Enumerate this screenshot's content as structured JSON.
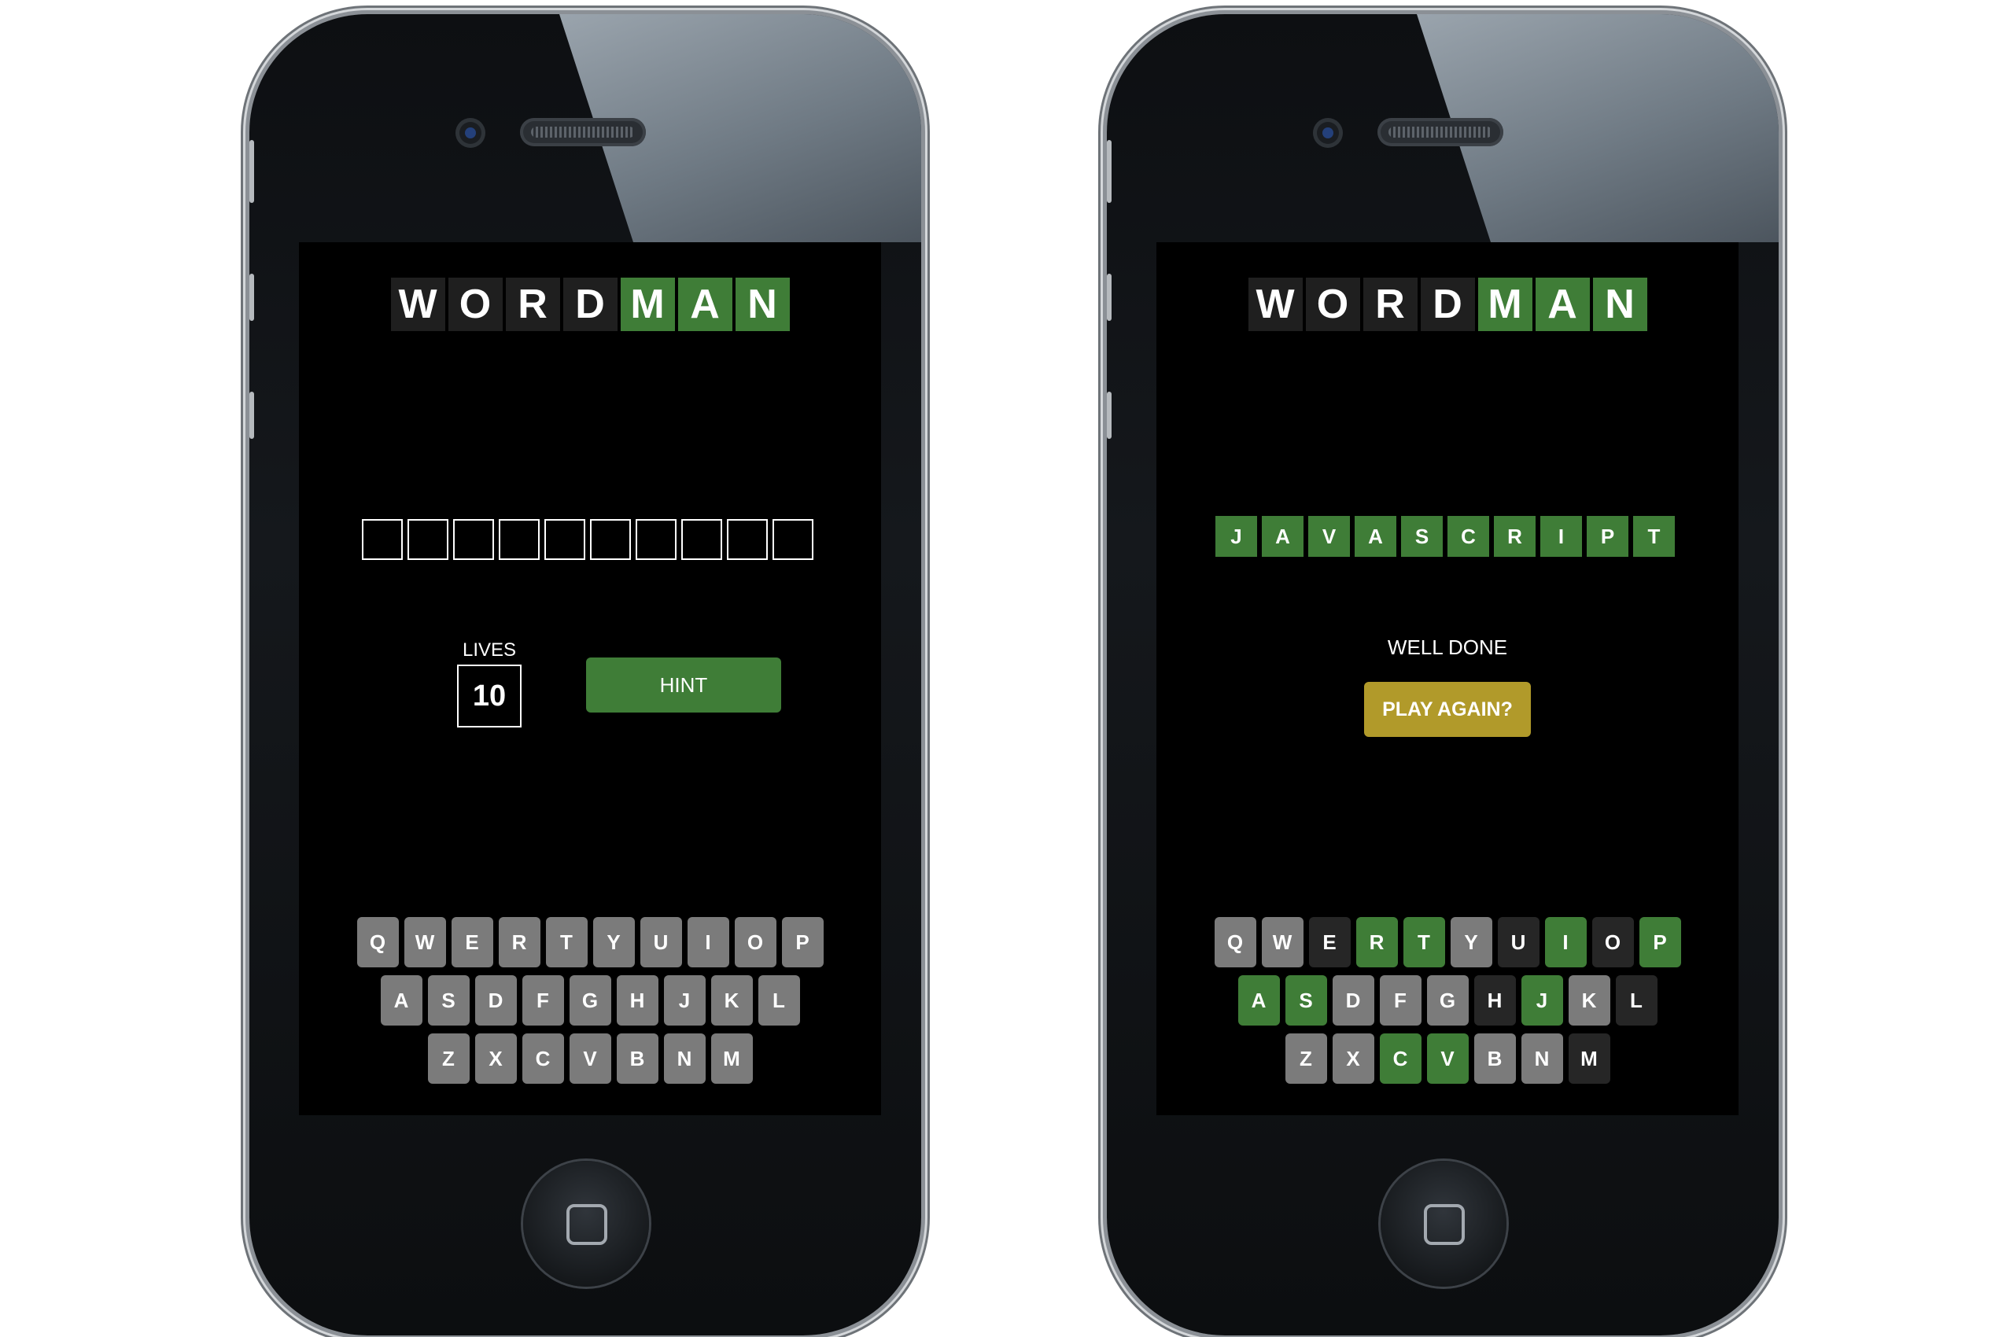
{
  "colors": {
    "correct": "#3f7d37",
    "absent": "#262626",
    "unused": "#7b7b7b",
    "play_again": "#b19a2a"
  },
  "title_letters": [
    "W",
    "O",
    "R",
    "D",
    "M",
    "A",
    "N"
  ],
  "left_screen": {
    "blank_count": 10,
    "lives_label": "LIVES",
    "lives": "10",
    "hint_label": "HINT",
    "keyboard": [
      [
        "Q",
        "W",
        "E",
        "R",
        "T",
        "Y",
        "U",
        "I",
        "O",
        "P"
      ],
      [
        "A",
        "S",
        "D",
        "F",
        "G",
        "H",
        "J",
        "K",
        "L"
      ],
      [
        "Z",
        "X",
        "C",
        "V",
        "B",
        "N",
        "M"
      ]
    ]
  },
  "right_screen": {
    "word": [
      "J",
      "A",
      "V",
      "A",
      "S",
      "C",
      "R",
      "I",
      "P",
      "T"
    ],
    "message": "WELL DONE",
    "play_again_label": "PLAY AGAIN?",
    "keyboard": [
      [
        {
          "key": "Q",
          "state": "unused"
        },
        {
          "key": "W",
          "state": "unused"
        },
        {
          "key": "E",
          "state": "absent"
        },
        {
          "key": "R",
          "state": "correct"
        },
        {
          "key": "T",
          "state": "correct"
        },
        {
          "key": "Y",
          "state": "unused"
        },
        {
          "key": "U",
          "state": "absent"
        },
        {
          "key": "I",
          "state": "correct"
        },
        {
          "key": "O",
          "state": "absent"
        },
        {
          "key": "P",
          "state": "correct"
        }
      ],
      [
        {
          "key": "A",
          "state": "correct"
        },
        {
          "key": "S",
          "state": "correct"
        },
        {
          "key": "D",
          "state": "unused"
        },
        {
          "key": "F",
          "state": "unused"
        },
        {
          "key": "G",
          "state": "unused"
        },
        {
          "key": "H",
          "state": "absent"
        },
        {
          "key": "J",
          "state": "correct"
        },
        {
          "key": "K",
          "state": "unused"
        },
        {
          "key": "L",
          "state": "absent"
        }
      ],
      [
        {
          "key": "Z",
          "state": "unused"
        },
        {
          "key": "X",
          "state": "unused"
        },
        {
          "key": "C",
          "state": "correct"
        },
        {
          "key": "V",
          "state": "correct"
        },
        {
          "key": "B",
          "state": "unused"
        },
        {
          "key": "N",
          "state": "unused"
        },
        {
          "key": "M",
          "state": "absent"
        }
      ]
    ]
  }
}
